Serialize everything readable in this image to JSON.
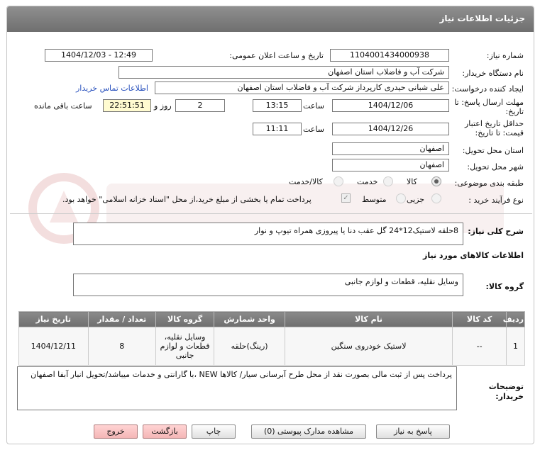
{
  "header": {
    "title": "جزئیات اطلاعات نیاز"
  },
  "fields": {
    "need_number_label": "شماره نیاز:",
    "need_number": "1104001434000938",
    "announce_label": "تاریخ و ساعت اعلان عمومی:",
    "announce_value": "1404/12/03 - 12:49",
    "buyer_org_label": "نام دستگاه خریدار:",
    "buyer_org": "شرکت آب و فاضلاب استان اصفهان",
    "requester_label": "ایجاد کننده درخواست:",
    "requester": "علی شبانی حیدری کارپرداز شرکت آب و فاضلاب استان اصفهان",
    "contact_link": "اطلاعات تماس خریدار",
    "deadline_label_1": "مهلت ارسال پاسخ: تا",
    "deadline_label_2": "تاریخ:",
    "deadline_date": "1404/12/06",
    "time_label": "ساعت",
    "deadline_time": "13:15",
    "days_count": "2",
    "days_label": "روز و",
    "remaining_time": "22:51:51",
    "remaining_label": "ساعت باقی مانده",
    "min_valid_label_1": "حداقل تاریخ اعتبار",
    "min_valid_label_2": "قیمت: تا تاریخ:",
    "valid_date": "1404/12/26",
    "valid_time": "11:11",
    "province_label": "استان محل تحویل:",
    "province": "اصفهان",
    "city_label": "شهر محل تحویل:",
    "city": "اصفهان",
    "category_label": "طبقه بندی موضوعی:",
    "category_options": [
      "کالا",
      "خدمت",
      "کالا/خدمت"
    ],
    "process_label": "نوع فرآیند خرید :",
    "process_options": [
      "جزیی",
      "متوسط"
    ],
    "payment_note": "پرداخت تمام یا بخشی از مبلغ خرید،از محل \"اسناد خزانه اسلامی\" خواهد بود."
  },
  "summary": {
    "label": "شرح کلی نیاز:",
    "value": "8حلقه لاستیک12*24 گل عقب دنا یا پیروزی همراه تیوپ و نوار"
  },
  "goods_info_title": "اطلاعات کالاهای مورد نیاز",
  "goods_group": {
    "label": "گروه کالا:",
    "value": "وسایل نقلیه، قطعات و لوازم جانبی"
  },
  "table": {
    "headers": [
      "ردیف",
      "کد کالا",
      "نام کالا",
      "واحد شمارش",
      "گروه کالا",
      "تعداد / مقدار",
      "تاریخ نیاز"
    ],
    "rows": [
      [
        "1",
        "--",
        "لاستیک خودروی سنگین",
        "(رینگ)حلقه",
        "وسایل نقلیه، قطعات و لوازم جانبی",
        "8",
        "1404/12/11"
      ]
    ]
  },
  "buyer_notes": {
    "label_1": "توضیحات",
    "label_2": "خریدار:",
    "value": "پرداخت پس از ثبت مالی بصورت نقد از محل طرح آبرسانی سیار/ کالاها  NEW  ،با گارانتی و خدمات میباشد/تحویل انبار آبفا اصفهان"
  },
  "buttons": {
    "reply": "پاسخ به نیاز",
    "attachments": "مشاهده مدارک پیوستی (0)",
    "print": "چاپ",
    "back": "بازگشت",
    "exit": "خروج"
  }
}
